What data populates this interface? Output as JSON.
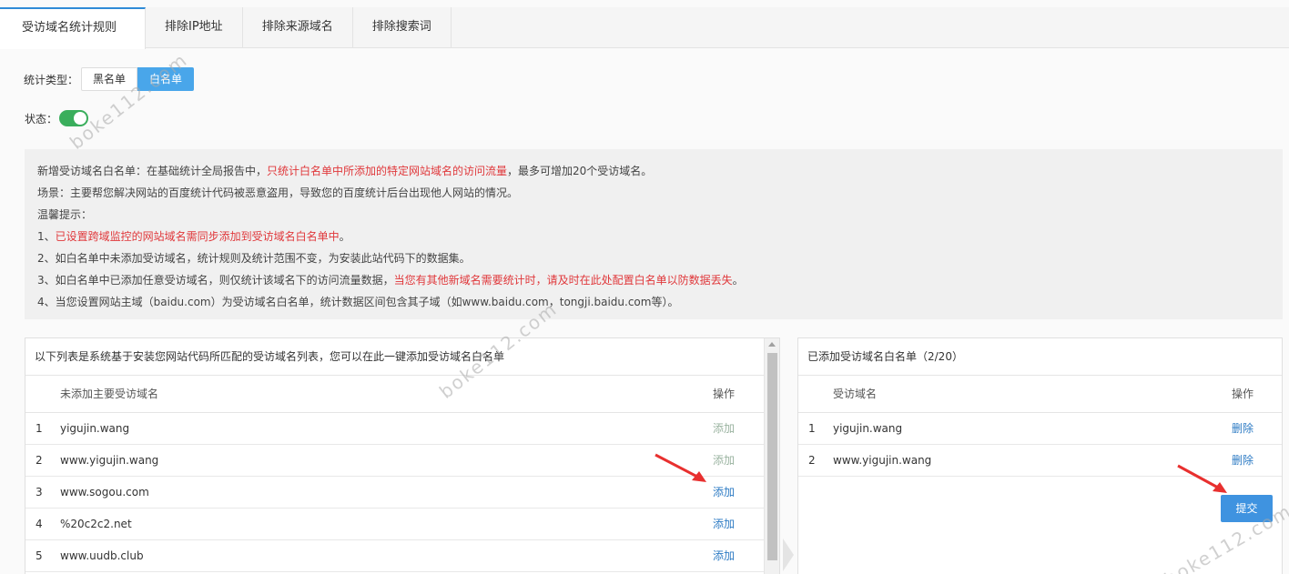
{
  "tabs": [
    {
      "label": "受访域名统计规则",
      "active": true
    },
    {
      "label": "排除IP地址",
      "active": false
    },
    {
      "label": "排除来源域名",
      "active": false
    },
    {
      "label": "排除搜索词",
      "active": false
    }
  ],
  "stat_type": {
    "label": "统计类型：",
    "options": [
      "黑名单",
      "白名单"
    ],
    "selected": "白名单"
  },
  "status": {
    "label": "状态：",
    "enabled": true
  },
  "info": {
    "line1_a": "新增受访域名白名单：在基础统计全局报告中，",
    "line1_b": "只统计白名单中所添加的特定网站域名的访问流量",
    "line1_c": "，最多可增加20个受访域名。",
    "line2": "场景：主要帮您解决网站的百度统计代码被恶意盗用，导致您的百度统计后台出现他人网站的情况。",
    "line3": "温馨提示：",
    "line4_a": "1、",
    "line4_b": "已设置跨域监控的网站域名需同步添加到受访域名白名单中",
    "line4_c": "。",
    "line5": "2、如白名单中未添加受访域名，统计规则及统计范围不变，为安装此站代码下的数据集。",
    "line6_a": "3、如白名单中已添加任意受访域名，则仅统计该域名下的访问流量数据，",
    "line6_b": "当您有其他新域名需要统计时，请及时在此处配置白名单以防数据丢失",
    "line6_c": "。",
    "line7": "4、当您设置网站主域（baidu.com）为受访域名白名单，统计数据区间包含其子域（如www.baidu.com，tongji.baidu.com等）。"
  },
  "left_panel": {
    "title": "以下列表是系统基于安装您网站代码所匹配的受访域名列表，您可以在此一键添加受访域名白名单",
    "col_name": "未添加主要受访域名",
    "col_op": "操作",
    "rows": [
      {
        "idx": "1",
        "name": "yigujin.wang",
        "op": "添加",
        "disabled": true
      },
      {
        "idx": "2",
        "name": "www.yigujin.wang",
        "op": "添加",
        "disabled": true
      },
      {
        "idx": "3",
        "name": "www.sogou.com",
        "op": "添加",
        "disabled": false
      },
      {
        "idx": "4",
        "name": "%20c2c2.net",
        "op": "添加",
        "disabled": false
      },
      {
        "idx": "5",
        "name": "www.uudb.club",
        "op": "添加",
        "disabled": false
      }
    ]
  },
  "right_panel": {
    "title": "已添加受访域名白名单（2/20）",
    "col_name": "受访域名",
    "col_op": "操作",
    "rows": [
      {
        "idx": "1",
        "name": "yigujin.wang",
        "op": "删除"
      },
      {
        "idx": "2",
        "name": "www.yigujin.wang",
        "op": "删除"
      }
    ]
  },
  "submit_label": "提交",
  "watermark": "boke112.com",
  "colors": {
    "accent": "#49a6ea",
    "red": "#e0383b",
    "toggle_on": "#3aae5c",
    "link": "#2d7bc4"
  }
}
